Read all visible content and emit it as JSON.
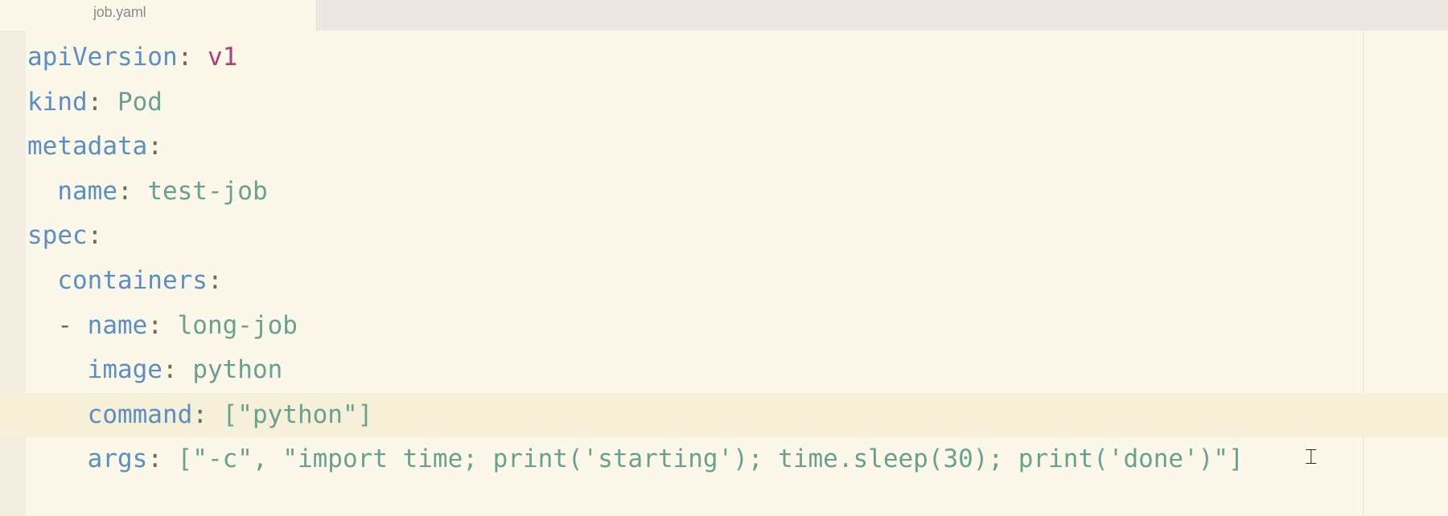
{
  "tab": {
    "filename": "job.yaml"
  },
  "editor": {
    "lines": [
      {
        "indent": "",
        "dash": "",
        "key": "apiVersion",
        "sep": ": ",
        "value": "v1",
        "value_kind": "num"
      },
      {
        "indent": "",
        "dash": "",
        "key": "kind",
        "sep": ": ",
        "value": "Pod",
        "value_kind": "str"
      },
      {
        "indent": "",
        "dash": "",
        "key": "metadata",
        "sep": ":",
        "value": "",
        "value_kind": "str"
      },
      {
        "indent": "  ",
        "dash": "",
        "key": "name",
        "sep": ": ",
        "value": "test-job",
        "value_kind": "str"
      },
      {
        "indent": "",
        "dash": "",
        "key": "spec",
        "sep": ":",
        "value": "",
        "value_kind": "str"
      },
      {
        "indent": "  ",
        "dash": "",
        "key": "containers",
        "sep": ":",
        "value": "",
        "value_kind": "str"
      },
      {
        "indent": "  ",
        "dash": "- ",
        "key": "name",
        "sep": ": ",
        "value": "long-job",
        "value_kind": "str"
      },
      {
        "indent": "    ",
        "dash": "",
        "key": "image",
        "sep": ": ",
        "value": "python",
        "value_kind": "str"
      },
      {
        "indent": "    ",
        "dash": "",
        "key": "command",
        "sep": ": ",
        "value": "[\"python\"]",
        "value_kind": "str",
        "current": true
      },
      {
        "indent": "    ",
        "dash": "",
        "key": "args",
        "sep": ": ",
        "value": "[\"-c\", \"import time; print('starting'); time.sleep(30); print('done')\"]",
        "value_kind": "str"
      }
    ]
  },
  "icons": {
    "text_cursor": "i-beam-cursor-icon"
  },
  "colors": {
    "key": "#5b8fc4",
    "string": "#6aa08f",
    "number": "#b03a7a",
    "background": "#fbf8ea"
  }
}
